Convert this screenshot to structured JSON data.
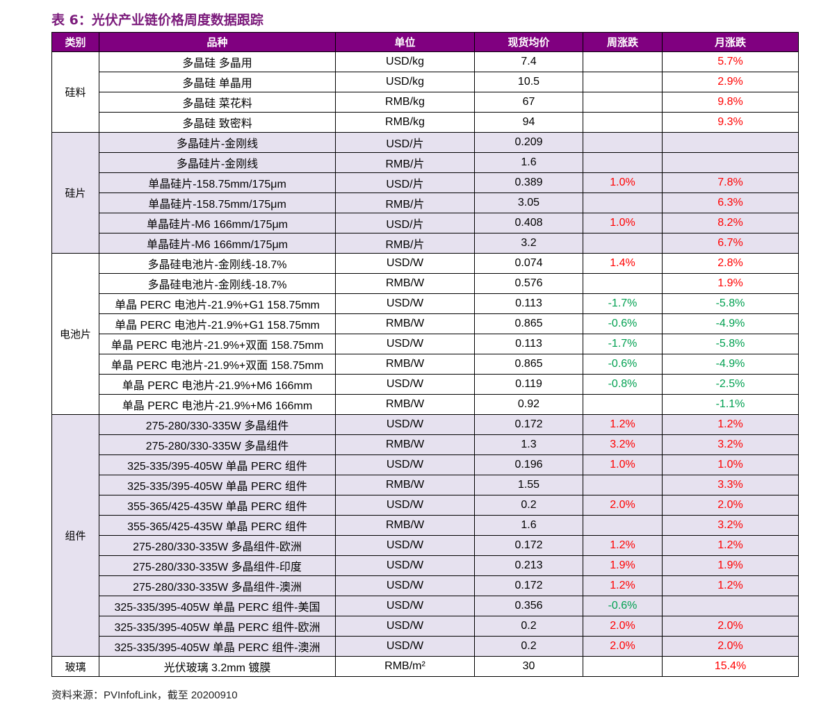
{
  "title": "表 6：光伏产业链价格周度数据跟踪",
  "headers": [
    "类别",
    "品种",
    "单位",
    "现货均价",
    "周涨跌",
    "月涨跌"
  ],
  "groups": [
    {
      "category": "硅料",
      "alt": false,
      "rows": [
        {
          "item": "多晶硅  多晶用",
          "unit": "USD/kg",
          "price": "7.4",
          "week": "",
          "month": "5.7%"
        },
        {
          "item": "多晶硅  单晶用",
          "unit": "USD/kg",
          "price": "10.5",
          "week": "",
          "month": "2.9%"
        },
        {
          "item": "多晶硅  菜花料",
          "unit": "RMB/kg",
          "price": "67",
          "week": "",
          "month": "9.8%"
        },
        {
          "item": "多晶硅  致密料",
          "unit": "RMB/kg",
          "price": "94",
          "week": "",
          "month": "9.3%"
        }
      ]
    },
    {
      "category": "硅片",
      "alt": true,
      "rows": [
        {
          "item": "多晶硅片-金刚线",
          "unit": "USD/片",
          "price": "0.209",
          "week": "",
          "month": ""
        },
        {
          "item": "多晶硅片-金刚线",
          "unit": "RMB/片",
          "price": "1.6",
          "week": "",
          "month": ""
        },
        {
          "item": "单晶硅片-158.75mm/175μm",
          "unit": "USD/片",
          "price": "0.389",
          "week": "1.0%",
          "month": "7.8%"
        },
        {
          "item": "单晶硅片-158.75mm/175μm",
          "unit": "RMB/片",
          "price": "3.05",
          "week": "",
          "month": "6.3%"
        },
        {
          "item": "单晶硅片-M6 166mm/175μm",
          "unit": "USD/片",
          "price": "0.408",
          "week": "1.0%",
          "month": "8.2%"
        },
        {
          "item": "单晶硅片-M6 166mm/175μm",
          "unit": "RMB/片",
          "price": "3.2",
          "week": "",
          "month": "6.7%"
        }
      ]
    },
    {
      "category": "电池片",
      "alt": false,
      "rows": [
        {
          "item": "多晶硅电池片-金刚线-18.7%",
          "unit": "USD/W",
          "price": "0.074",
          "week": "1.4%",
          "month": "2.8%"
        },
        {
          "item": "多晶硅电池片-金刚线-18.7%",
          "unit": "RMB/W",
          "price": "0.576",
          "week": "",
          "month": "1.9%"
        },
        {
          "item": "单晶 PERC 电池片-21.9%+G1 158.75mm",
          "unit": "USD/W",
          "price": "0.113",
          "week": "-1.7%",
          "month": "-5.8%"
        },
        {
          "item": "单晶 PERC 电池片-21.9%+G1 158.75mm",
          "unit": "RMB/W",
          "price": "0.865",
          "week": "-0.6%",
          "month": "-4.9%"
        },
        {
          "item": "单晶 PERC 电池片-21.9%+双面 158.75mm",
          "unit": "USD/W",
          "price": "0.113",
          "week": "-1.7%",
          "month": "-5.8%"
        },
        {
          "item": "单晶 PERC 电池片-21.9%+双面 158.75mm",
          "unit": "RMB/W",
          "price": "0.865",
          "week": "-0.6%",
          "month": "-4.9%"
        },
        {
          "item": "单晶 PERC 电池片-21.9%+M6 166mm",
          "unit": "USD/W",
          "price": "0.119",
          "week": "-0.8%",
          "month": "-2.5%"
        },
        {
          "item": "单晶 PERC 电池片-21.9%+M6 166mm",
          "unit": "RMB/W",
          "price": "0.92",
          "week": "",
          "month": "-1.1%"
        }
      ]
    },
    {
      "category": "组件",
      "alt": true,
      "rows": [
        {
          "item": "275-280/330-335W 多晶组件",
          "unit": "USD/W",
          "price": "0.172",
          "week": "1.2%",
          "month": "1.2%"
        },
        {
          "item": "275-280/330-335W 多晶组件",
          "unit": "RMB/W",
          "price": "1.3",
          "week": "3.2%",
          "month": "3.2%"
        },
        {
          "item": "325-335/395-405W 单晶 PERC 组件",
          "unit": "USD/W",
          "price": "0.196",
          "week": "1.0%",
          "month": "1.0%"
        },
        {
          "item": "325-335/395-405W 单晶 PERC 组件",
          "unit": "RMB/W",
          "price": "1.55",
          "week": "",
          "month": "3.3%"
        },
        {
          "item": "355-365/425-435W 单晶 PERC 组件",
          "unit": "USD/W",
          "price": "0.2",
          "week": "2.0%",
          "month": "2.0%"
        },
        {
          "item": "355-365/425-435W 单晶 PERC 组件",
          "unit": "RMB/W",
          "price": "1.6",
          "week": "",
          "month": "3.2%"
        },
        {
          "item": "275-280/330-335W 多晶组件-欧洲",
          "unit": "USD/W",
          "price": "0.172",
          "week": "1.2%",
          "month": "1.2%"
        },
        {
          "item": "275-280/330-335W 多晶组件-印度",
          "unit": "USD/W",
          "price": "0.213",
          "week": "1.9%",
          "month": "1.9%"
        },
        {
          "item": "275-280/330-335W 多晶组件-澳洲",
          "unit": "USD/W",
          "price": "0.172",
          "week": "1.2%",
          "month": "1.2%"
        },
        {
          "item": "325-335/395-405W 单晶 PERC 组件-美国",
          "unit": "USD/W",
          "price": "0.356",
          "week": "-0.6%",
          "month": ""
        },
        {
          "item": "325-335/395-405W 单晶 PERC 组件-欧洲",
          "unit": "USD/W",
          "price": "0.2",
          "week": "2.0%",
          "month": "2.0%"
        },
        {
          "item": "325-335/395-405W 单晶 PERC 组件-澳洲",
          "unit": "USD/W",
          "price": "0.2",
          "week": "2.0%",
          "month": "2.0%"
        }
      ]
    },
    {
      "category": "玻璃",
      "alt": false,
      "rows": [
        {
          "item": "光伏玻璃 3.2mm 镀膜",
          "unit": "RMB/m²",
          "price": "30",
          "week": "",
          "month": "15.4%"
        }
      ]
    }
  ],
  "source": "资料来源：PVInfofLink，截至 20200910"
}
